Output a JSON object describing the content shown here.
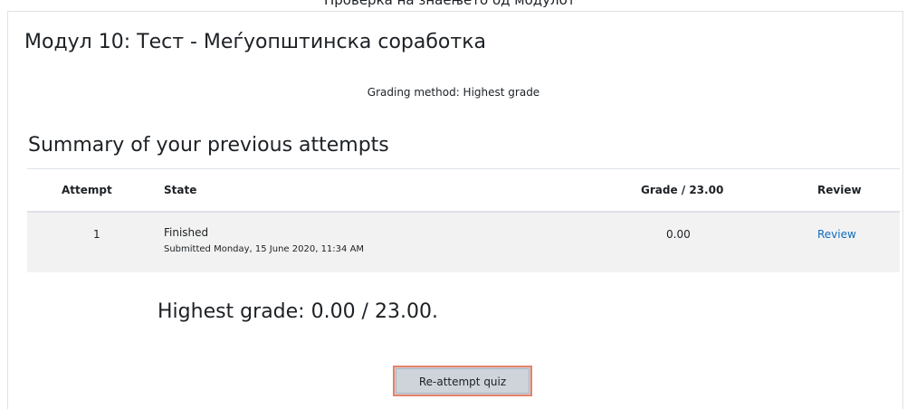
{
  "top_strip": {
    "text": "Проверка на знаењето од модулот"
  },
  "quiz": {
    "title": "Модул 10: Тест - Меѓуопштинска соработка",
    "grading_method": "Grading method: Highest grade"
  },
  "summary": {
    "heading": "Summary of your previous attempts",
    "columns": [
      "Attempt",
      "State",
      "Grade / 23.00",
      "Review"
    ],
    "rows": [
      {
        "attempt": "1",
        "state": "Finished",
        "submitted": "Submitted Monday, 15 June 2020, 11:34 AM",
        "grade": "0.00",
        "review": "Review"
      }
    ]
  },
  "result": {
    "highest_grade": "Highest grade: 0.00 / 23.00."
  },
  "actions": {
    "reattempt_label": "Re-attempt quiz"
  },
  "colors": {
    "link": "#0f6cbf",
    "button_focus_outline": "#e8816a",
    "button_bg": "#ced4da",
    "row_bg": "#f2f2f2"
  }
}
